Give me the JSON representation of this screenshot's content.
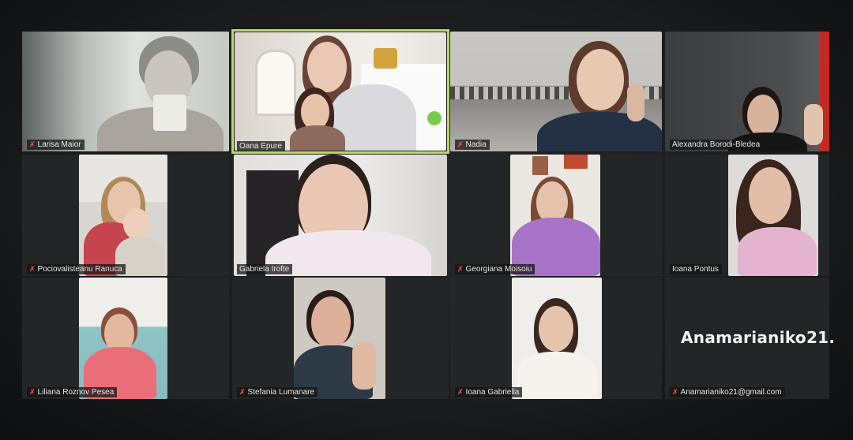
{
  "meeting": {
    "watermark": "Anamarianiko21.",
    "participants": [
      {
        "name": "Larisa Maior",
        "muted": true
      },
      {
        "name": "Oana Epure",
        "muted": false,
        "active_speaker": true
      },
      {
        "name": "Nadia",
        "muted": true
      },
      {
        "name": "Alexandra Borodi-Bledea",
        "muted": false
      },
      {
        "name": "Pociovalisteanu Ranuca",
        "muted": true
      },
      {
        "name": "Gabriela Irofte",
        "muted": false
      },
      {
        "name": "Georgiana Moisoiu",
        "muted": true
      },
      {
        "name": "Ioana Pontus",
        "muted": false
      },
      {
        "name": "Liliana Roznov Pesea",
        "muted": true
      },
      {
        "name": "Stefania Lumanare",
        "muted": true
      },
      {
        "name": "Ioana Gabriella",
        "muted": true
      },
      {
        "name": "Anamarianiko21@gmail.com",
        "muted": true
      }
    ]
  },
  "icons": {
    "muted_mic": "muted-microphone-icon"
  },
  "colors": {
    "active_speaker_border": "#b9d86a",
    "muted_icon": "#e0434b",
    "background": "#141516"
  }
}
